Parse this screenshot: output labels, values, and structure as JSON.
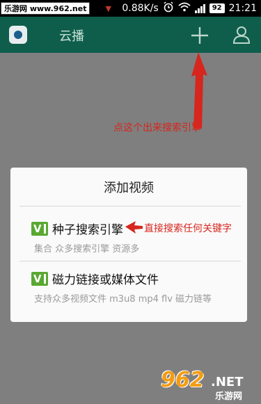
{
  "status_bar": {
    "watermark": "乐游网 www.962.net",
    "speed": "0.88K/s",
    "battery": "92",
    "time": "21:21"
  },
  "app_bar": {
    "title": "云播",
    "add_icon": "plus-icon",
    "user_icon": "user-icon",
    "accent_color": "#0f5e4c"
  },
  "annotations": {
    "top_note": "点这个出来搜索引擎",
    "option_note": "直接搜索任何关键字",
    "color": "#d6261d"
  },
  "dialog": {
    "title": "添加视频",
    "options": [
      {
        "icon_label": "V",
        "title": "种子搜索引擎",
        "desc": "集合 众多搜索引擎 资源多"
      },
      {
        "icon_label": "V",
        "title": "磁力链接或媒体文件",
        "desc": "支持众多视频文件 m3u8 mp4 flv 磁力链等"
      }
    ]
  },
  "watermark_br": {
    "number": "962",
    "net": ".NET",
    "cn": "乐游网"
  }
}
